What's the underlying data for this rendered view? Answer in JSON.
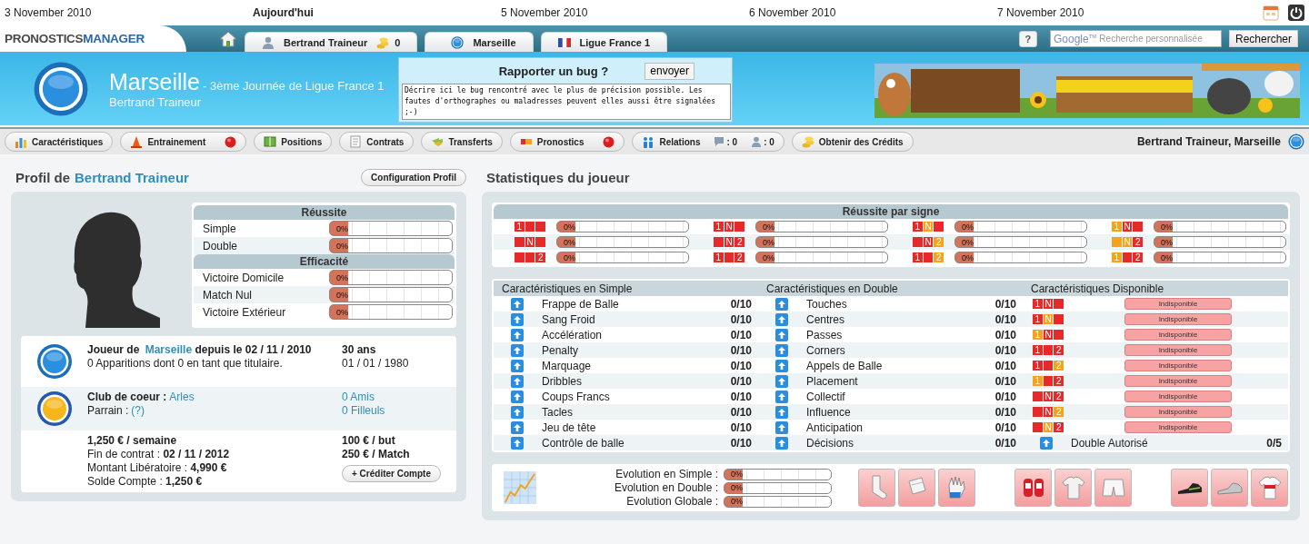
{
  "dates": [
    {
      "label": "3 November 2010",
      "today": false
    },
    {
      "label": "Aujourd'hui",
      "today": true
    },
    {
      "label": "5 November 2010",
      "today": false
    },
    {
      "label": "6 November 2010",
      "today": false
    },
    {
      "label": "7 November 2010",
      "today": false
    }
  ],
  "nav": {
    "logo": [
      "PRONOSTICS",
      "MANAGER"
    ],
    "tabs": [
      {
        "kind": "user",
        "label": "Bertrand Traineur",
        "credits": "0"
      },
      {
        "kind": "club",
        "label": "Marseille"
      },
      {
        "kind": "league",
        "label": "Ligue France 1"
      }
    ],
    "help": "?",
    "search": {
      "brand": "Google$^{TM}$",
      "placeholder": "Recherche personnalisée"
    },
    "search_button": "Rechercher"
  },
  "header": {
    "club": "Marseille",
    "subtitle": "- 3ème Journée de Ligue France 1",
    "manager": "Bertrand Traineur",
    "bug_report": {
      "title": "Rapporter un bug ?",
      "button": "envoyer",
      "value": "Décrire ici le bug rencontré avec le plus de précision possible. Les fautes d'orthographes ou maladresses peuvent elles aussi être signalées ;-)"
    }
  },
  "toolbar": {
    "buttons": [
      {
        "kind": "stats",
        "label": "Caractéristiques",
        "alert": false
      },
      {
        "kind": "training",
        "label": "Entrainement",
        "alert": true
      },
      {
        "kind": "positions",
        "label": "Positions",
        "alert": false
      },
      {
        "kind": "contracts",
        "label": "Contrats",
        "alert": false
      },
      {
        "kind": "transfers",
        "label": "Transferts",
        "alert": false
      },
      {
        "kind": "pronostics",
        "label": "Pronostics",
        "alert": true
      },
      {
        "kind": "relations",
        "label": "Relations",
        "alert": false,
        "counts": [
          {
            "kind": "message",
            "text": ": 0"
          },
          {
            "kind": "user",
            "text": ": 0"
          }
        ]
      },
      {
        "kind": "credits",
        "label": "Obtenir des Crédits",
        "alert": false
      }
    ],
    "user": "Bertrand Traineur, Marseille"
  },
  "profile": {
    "title": "Profil de",
    "name": "Bertrand Traineur",
    "config_button": "Configuration Profil",
    "ratings": [
      {
        "title": "Réussite",
        "rows": [
          {
            "label": "Simple",
            "reading": "0%",
            "level": 0
          },
          {
            "label": "Double",
            "reading": "0%",
            "level": 0
          }
        ]
      },
      {
        "title": "Efficacité",
        "rows": [
          {
            "label": "Victoire Domicile",
            "reading": "0%",
            "level": 0
          },
          {
            "label": "Match Nul",
            "reading": "0%",
            "level": 0
          },
          {
            "label": "Victoire Extérieur",
            "reading": "0%",
            "level": 0
          }
        ]
      }
    ],
    "career": {
      "prefix": "Joueur de",
      "club": "Marseille",
      "suffix": "depuis le 02 / 11 / 2010",
      "appearances": "0 Apparitions dont 0 en tant que titulaire.",
      "age": "30 ans",
      "birthdate": "01 / 01 / 1980"
    },
    "social": {
      "club_label": "Club de coeur :",
      "club": "Arles",
      "sponsor_label": "Parrain :",
      "sponsor": "(?)",
      "friends": "0 Amis",
      "referrals": "0 Filleuls"
    },
    "finance": {
      "salary": "1,250 € / semaine",
      "lines": [
        "Fin de contrat : **02 / 11 / 2012**",
        "Montant Libératoire : **4,990 €**",
        "Solde Compte : **1,250 €**"
      ],
      "goal_bonus": "100 € / but",
      "match_bonus": "250 € / Match",
      "credit_button": "+ Créditer Compte"
    }
  },
  "stats": {
    "title": "Statistiques du joueur",
    "by_sign": {
      "title": "Réussite par signe",
      "items": [
        {
          "cells": [
            {
              "text": "1",
              "color": "#e62a2a"
            },
            {
              "color": "#e62a2a"
            },
            {
              "color": "#e62a2a"
            }
          ],
          "reading": "0%",
          "level": 0
        },
        {
          "cells": [
            {
              "text": "1",
              "color": "#e62a2a"
            },
            {
              "text": "N",
              "color": "#e62a2a"
            },
            {
              "color": "#e62a2a"
            }
          ],
          "reading": "0%",
          "level": 0
        },
        {
          "cells": [
            {
              "text": "1",
              "color": "#e62a2a"
            },
            {
              "text": "N",
              "color": "#f7a21b"
            },
            {
              "color": "#e62a2a"
            }
          ],
          "reading": "0%",
          "level": 0
        },
        {
          "cells": [
            {
              "text": "1",
              "color": "#f7a21b"
            },
            {
              "text": "N",
              "color": "#e62a2a"
            },
            {
              "color": "#e62a2a"
            }
          ],
          "reading": "0%",
          "level": 0
        },
        {
          "cells": [
            {
              "color": "#e62a2a"
            },
            {
              "text": "N",
              "color": "#e62a2a"
            },
            {
              "color": "#e62a2a"
            }
          ],
          "reading": "0%",
          "level": 0
        },
        {
          "cells": [
            {
              "color": "#e62a2a"
            },
            {
              "text": "N",
              "color": "#e62a2a"
            },
            {
              "text": "2",
              "color": "#e62a2a"
            }
          ],
          "reading": "0%",
          "level": 0
        },
        {
          "cells": [
            {
              "color": "#e62a2a"
            },
            {
              "text": "N",
              "color": "#e62a2a"
            },
            {
              "text": "2",
              "color": "#f7a21b"
            }
          ],
          "reading": "0%",
          "level": 0
        },
        {
          "cells": [
            {
              "color": "#f7a21b"
            },
            {
              "text": "N",
              "color": "#f7a21b"
            },
            {
              "text": "2",
              "color": "#e62a2a"
            }
          ],
          "reading": "0%",
          "level": 0
        },
        {
          "cells": [
            {
              "color": "#e62a2a"
            },
            {
              "color": "#e62a2a"
            },
            {
              "text": "2",
              "color": "#e62a2a"
            }
          ],
          "reading": "0%",
          "level": 0
        },
        {
          "cells": [
            {
              "text": "1",
              "color": "#e62a2a"
            },
            {
              "color": "#e62a2a"
            },
            {
              "text": "2",
              "color": "#e62a2a"
            }
          ],
          "reading": "0%",
          "level": 0
        },
        {
          "cells": [
            {
              "text": "1",
              "color": "#e62a2a"
            },
            {
              "color": "#e62a2a"
            },
            {
              "text": "2",
              "color": "#f7a21b"
            }
          ],
          "reading": "0%",
          "level": 0
        },
        {
          "cells": [
            {
              "text": "1",
              "color": "#f7a21b"
            },
            {
              "color": "#e62a2a"
            },
            {
              "text": "2",
              "color": "#e62a2a"
            }
          ],
          "reading": "0%",
          "level": 0
        }
      ]
    },
    "simple": {
      "title": "Caractéristiques en Simple",
      "rows": [
        {
          "name": "Frappe de Balle",
          "value": "0/10"
        },
        {
          "name": "Sang Froid",
          "value": "0/10"
        },
        {
          "name": "Accélération",
          "value": "0/10"
        },
        {
          "name": "Penalty",
          "value": "0/10"
        },
        {
          "name": "Marquage",
          "value": "0/10"
        },
        {
          "name": "Dribbles",
          "value": "0/10"
        },
        {
          "name": "Coups Francs",
          "value": "0/10"
        },
        {
          "name": "Tacles",
          "value": "0/10"
        },
        {
          "name": "Jeu de tête",
          "value": "0/10"
        },
        {
          "name": "Contrôle de balle",
          "value": "0/10"
        }
      ]
    },
    "double": {
      "title": "Caractéristiques en Double",
      "rows": [
        {
          "name": "Touches",
          "value": "0/10"
        },
        {
          "name": "Centres",
          "value": "0/10"
        },
        {
          "name": "Passes",
          "value": "0/10"
        },
        {
          "name": "Corners",
          "value": "0/10"
        },
        {
          "name": "Appels de Balle",
          "value": "0/10"
        },
        {
          "name": "Placement",
          "value": "0/10"
        },
        {
          "name": "Collectif",
          "value": "0/10"
        },
        {
          "name": "Influence",
          "value": "0/10"
        },
        {
          "name": "Anticipation",
          "value": "0/10"
        },
        {
          "name": "Décisions",
          "value": "0/10"
        }
      ]
    },
    "available": {
      "title": "Caractéristiques Disponible",
      "rows": [
        {
          "cells": [
            {
              "text": "1",
              "color": "#e62a2a"
            },
            {
              "text": "N",
              "color": "#e62a2a"
            },
            {
              "color": "#e62a2a"
            }
          ],
          "status": "Indisponible"
        },
        {
          "cells": [
            {
              "text": "1",
              "color": "#e62a2a"
            },
            {
              "text": "N",
              "color": "#f7a21b"
            },
            {
              "color": "#e62a2a"
            }
          ],
          "status": "Indisponible"
        },
        {
          "cells": [
            {
              "text": "1",
              "color": "#f7a21b"
            },
            {
              "text": "N",
              "color": "#e62a2a"
            },
            {
              "color": "#e62a2a"
            }
          ],
          "status": "Indisponible"
        },
        {
          "cells": [
            {
              "text": "1",
              "color": "#e62a2a"
            },
            {
              "color": "#e62a2a"
            },
            {
              "text": "2",
              "color": "#e62a2a"
            }
          ],
          "status": "Indisponible"
        },
        {
          "cells": [
            {
              "text": "1",
              "color": "#e62a2a"
            },
            {
              "color": "#e62a2a"
            },
            {
              "text": "2",
              "color": "#f7a21b"
            }
          ],
          "status": "Indisponible"
        },
        {
          "cells": [
            {
              "text": "1",
              "color": "#f7a21b"
            },
            {
              "color": "#e62a2a"
            },
            {
              "text": "2",
              "color": "#e62a2a"
            }
          ],
          "status": "Indisponible"
        },
        {
          "cells": [
            {
              "color": "#e62a2a"
            },
            {
              "text": "N",
              "color": "#e62a2a"
            },
            {
              "text": "2",
              "color": "#e62a2a"
            }
          ],
          "status": "Indisponible"
        },
        {
          "cells": [
            {
              "color": "#e62a2a"
            },
            {
              "text": "N",
              "color": "#e62a2a"
            },
            {
              "text": "2",
              "color": "#f7a21b"
            }
          ],
          "status": "Indisponible"
        },
        {
          "cells": [
            {
              "color": "#e62a2a"
            },
            {
              "text": "N",
              "color": "#f7a21b"
            },
            {
              "text": "2",
              "color": "#e62a2a"
            }
          ],
          "status": "Indisponible"
        }
      ],
      "extra": {
        "label": "Double Autorisé",
        "value": "0/5"
      }
    },
    "evolution": {
      "rows": [
        {
          "label": "Evolution en Simple :",
          "reading": "0%",
          "level": 0
        },
        {
          "label": "Evolution en Double :",
          "reading": "0%",
          "level": 0
        },
        {
          "label": "Evolution Globale :",
          "reading": "0%",
          "level": 0
        }
      ],
      "equipment": [
        [
          {
            "kind": "sock"
          },
          {
            "kind": "pad"
          },
          {
            "kind": "glove"
          }
        ],
        [
          {
            "kind": "guard"
          },
          {
            "kind": "undershirt"
          },
          {
            "kind": "shorts"
          }
        ],
        [
          {
            "kind": "boot"
          },
          {
            "kind": "spike"
          },
          {
            "kind": "jersey"
          }
        ]
      ]
    }
  }
}
